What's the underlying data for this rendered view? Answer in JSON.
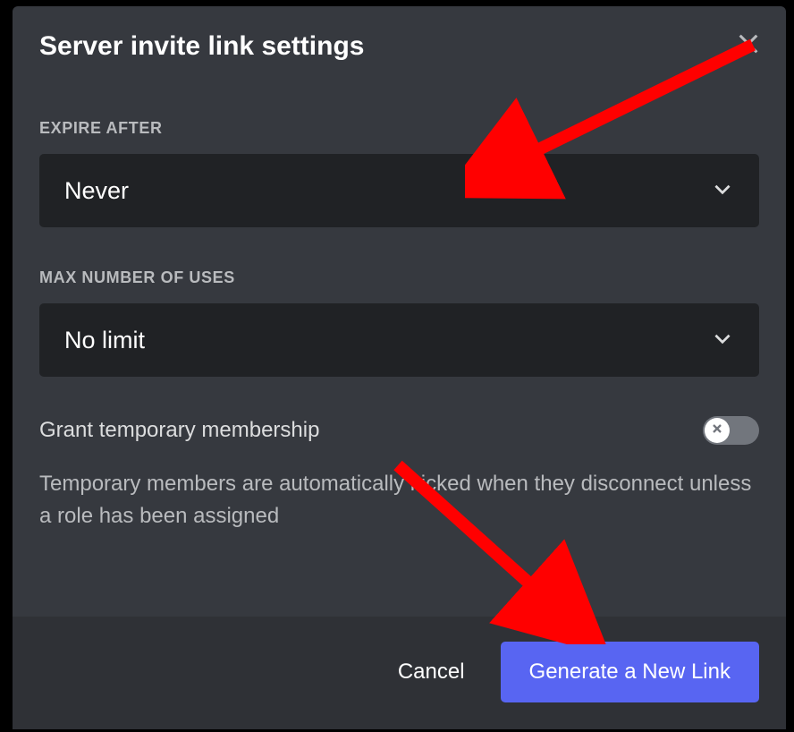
{
  "modal": {
    "title": "Server invite link settings",
    "expire": {
      "label": "EXPIRE AFTER",
      "value": "Never"
    },
    "maxUses": {
      "label": "MAX NUMBER OF USES",
      "value": "No limit"
    },
    "tempMembership": {
      "label": "Grant temporary membership",
      "helpText": "Temporary members are automatically kicked when they disconnect unless a role has been assigned",
      "enabled": false
    },
    "footer": {
      "cancel": "Cancel",
      "generate": "Generate a New Link"
    }
  }
}
